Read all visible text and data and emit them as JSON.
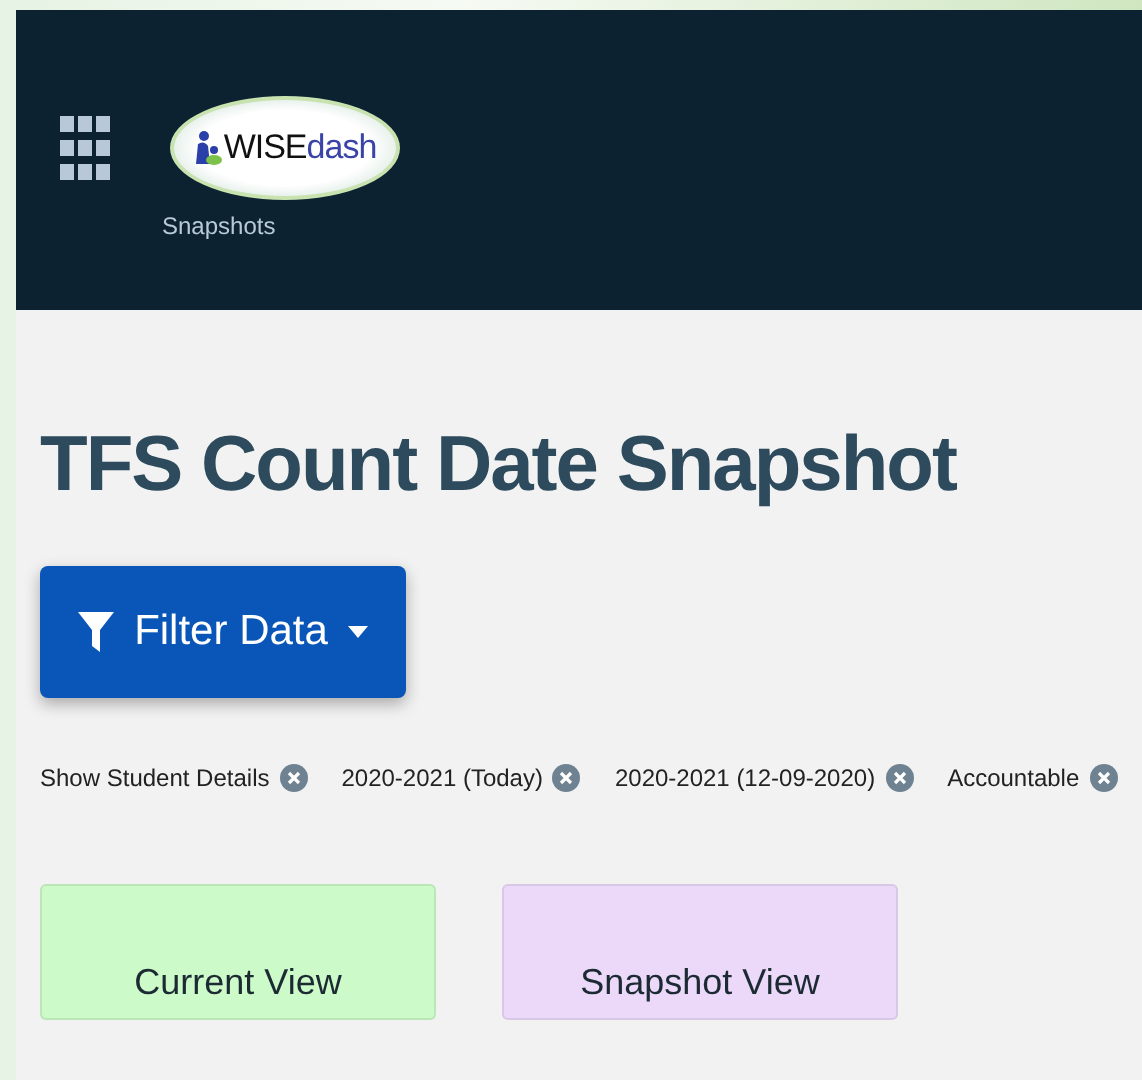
{
  "header": {
    "logo": {
      "part_1": "WISE",
      "part_2": "dash"
    },
    "subtitle": "Snapshots"
  },
  "title": "TFS Count Date Snapshot",
  "filter_button": {
    "label": "Filter Data"
  },
  "filters": [
    {
      "label": "Show Student Details"
    },
    {
      "label": "2020-2021 (Today)"
    },
    {
      "label": "2020-2021 (12-09-2020)"
    },
    {
      "label": "Accountable"
    }
  ],
  "views": [
    {
      "label": "Current View",
      "color": "#ccfac8"
    },
    {
      "label": "Snapshot View",
      "color": "#ecd9f9"
    }
  ]
}
